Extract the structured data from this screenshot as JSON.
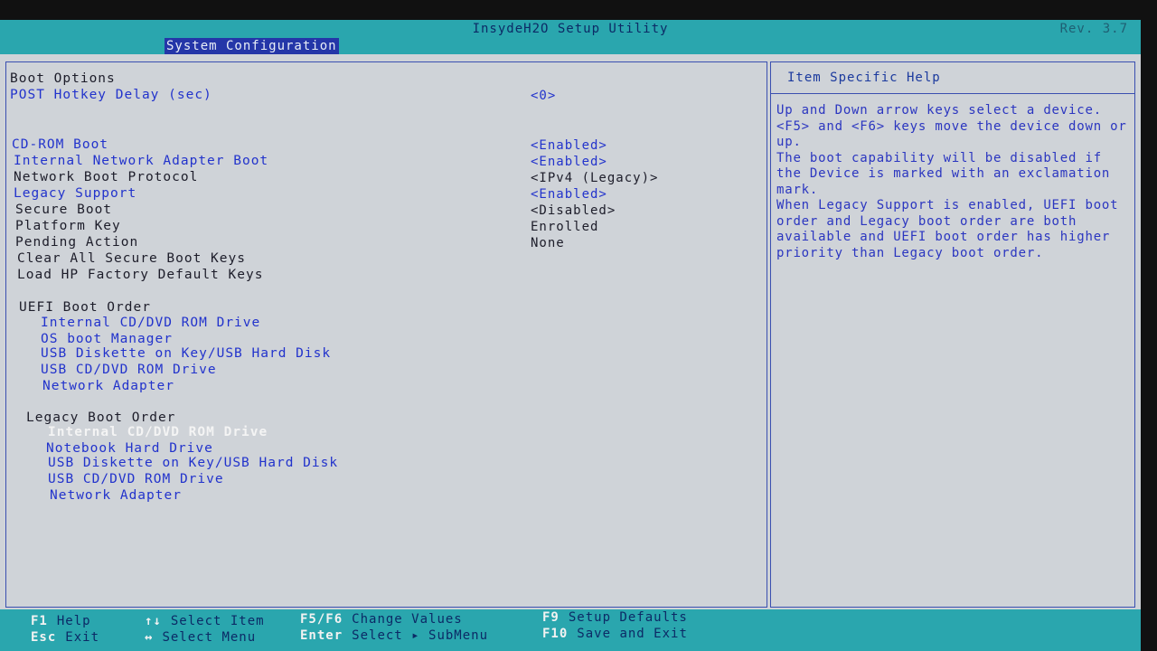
{
  "title": "InsydeH2O Setup Utility",
  "revision": "Rev. 3.7",
  "menu": {
    "active_tab": "System Configuration"
  },
  "settings": {
    "boot_options_heading": "Boot Options",
    "post_hotkey": {
      "label": "POST Hotkey Delay (sec)",
      "value": "<0>"
    },
    "cdrom_boot": {
      "label": "CD-ROM Boot",
      "value": "<Enabled>"
    },
    "network_adapter_boot": {
      "label": "Internal Network Adapter Boot",
      "value": "<Enabled>"
    },
    "network_boot_protocol": {
      "label": "Network Boot Protocol",
      "value": "<IPv4 (Legacy)>"
    },
    "legacy_support": {
      "label": "Legacy Support",
      "value": "<Enabled>"
    },
    "secure_boot": {
      "label": "Secure Boot",
      "value": "<Disabled>"
    },
    "platform_key": {
      "label": "Platform Key",
      "value": "Enrolled"
    },
    "pending_action": {
      "label": "Pending Action",
      "value": "None"
    },
    "clear_keys": {
      "label": "Clear All Secure Boot Keys"
    },
    "load_hp_keys": {
      "label": "Load HP Factory Default Keys"
    }
  },
  "uefi_boot_order": {
    "heading": "UEFI Boot Order",
    "items": [
      "Internal CD/DVD ROM Drive",
      "OS boot Manager",
      "USB Diskette on Key/USB Hard Disk",
      "USB CD/DVD ROM Drive",
      "Network Adapter"
    ]
  },
  "legacy_boot_order": {
    "heading": "Legacy Boot Order",
    "items": [
      "Internal CD/DVD ROM Drive",
      "Notebook Hard Drive",
      "USB Diskette on Key/USB Hard Disk",
      "USB CD/DVD ROM Drive",
      "Network Adapter"
    ],
    "selected_index": 0
  },
  "help": {
    "header": "Item Specific Help",
    "paragraphs": [
      "Up and Down arrow keys select a device. <F5> and <F6> keys move the device down or up.",
      "The boot capability will be disabled if the Device is marked with an exclamation mark.",
      "When Legacy Support is enabled, UEFI boot order and Legacy boot order are both available and UEFI boot order has higher priority than Legacy boot order."
    ]
  },
  "footer": {
    "f1": {
      "key": "F1",
      "desc": "Help"
    },
    "esc": {
      "key": "Esc",
      "desc": "Exit"
    },
    "updown": {
      "key": "↑↓",
      "desc": "Select Item"
    },
    "leftright": {
      "key": "↔",
      "desc": "Select Menu"
    },
    "f5f6": {
      "key": "F5/F6",
      "desc": "Change Values"
    },
    "enter": {
      "key": "Enter",
      "desc": "Select ▸ SubMenu"
    },
    "f9": {
      "key": "F9",
      "desc": "Setup Defaults"
    },
    "f10": {
      "key": "F10",
      "desc": "Save and Exit"
    }
  },
  "colors": {
    "title_bar": "#2aa6ae",
    "selected_tab": "#2436a8",
    "background": "#cfd3d8",
    "link_blue": "#2233cc"
  }
}
